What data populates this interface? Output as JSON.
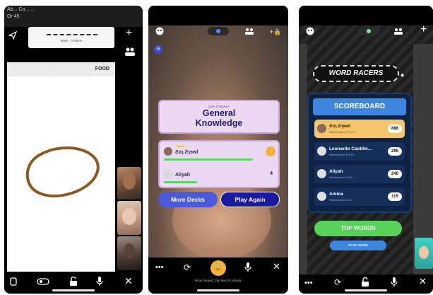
{
  "phone1": {
    "status_line1": "Ab... Co... ...",
    "status_line2": "Or 45",
    "word_hint": "Mask - 4 letters",
    "canvas_label": "FOOD",
    "canvas_center": "...",
    "icons": {
      "send": "send-icon",
      "plus": "plus-icon",
      "users": "users-icon",
      "phone": "phone-icon",
      "toggle": "toggle-icon",
      "unlock": "unlock-icon",
      "mic": "mic-icon",
      "close": "close-icon"
    }
  },
  "phone2": {
    "quiz_kicker": "Quiz Endgame",
    "quiz_title_line1": "General",
    "quiz_title_line2": "Knowledge",
    "winner_badge": "Winner",
    "players": [
      {
        "name": "Ƨɒɿ.Ƨɿɘwl",
        "score": "",
        "bar": 0.8,
        "bar_color": "#5fd36b"
      },
      {
        "name": "Aliyah",
        "score": "4",
        "bar": 0.3,
        "bar_color": "#5fd36b"
      }
    ],
    "more_decks_label": "More Decks",
    "play_again_label": "Play Again",
    "notice": "Room locked. Tap here to unlock.",
    "badge": "S"
  },
  "phone3": {
    "logo_text": "WORD RACERS",
    "board_title": "SCOREBOARD",
    "rows": [
      {
        "kicker": "Winner",
        "name": "Ƨɒɿ.Ƨɿɘwl",
        "sub": "Words found 17 12 3",
        "score": "888",
        "highlight": true
      },
      {
        "kicker": "",
        "name": "Leonardo Castillo...",
        "sub": "Words found 6 5 15",
        "score": "295",
        "highlight": false
      },
      {
        "kicker": "",
        "name": "Aliyah",
        "sub": "Words found 4 4 8",
        "score": "240",
        "highlight": false
      },
      {
        "kicker": "",
        "name": "Amina",
        "sub": "Words found 2 2 0",
        "score": "115",
        "highlight": false
      }
    ],
    "top_words_label": "TOP WORDS",
    "play_again_label": "PLAY AGAIN"
  }
}
